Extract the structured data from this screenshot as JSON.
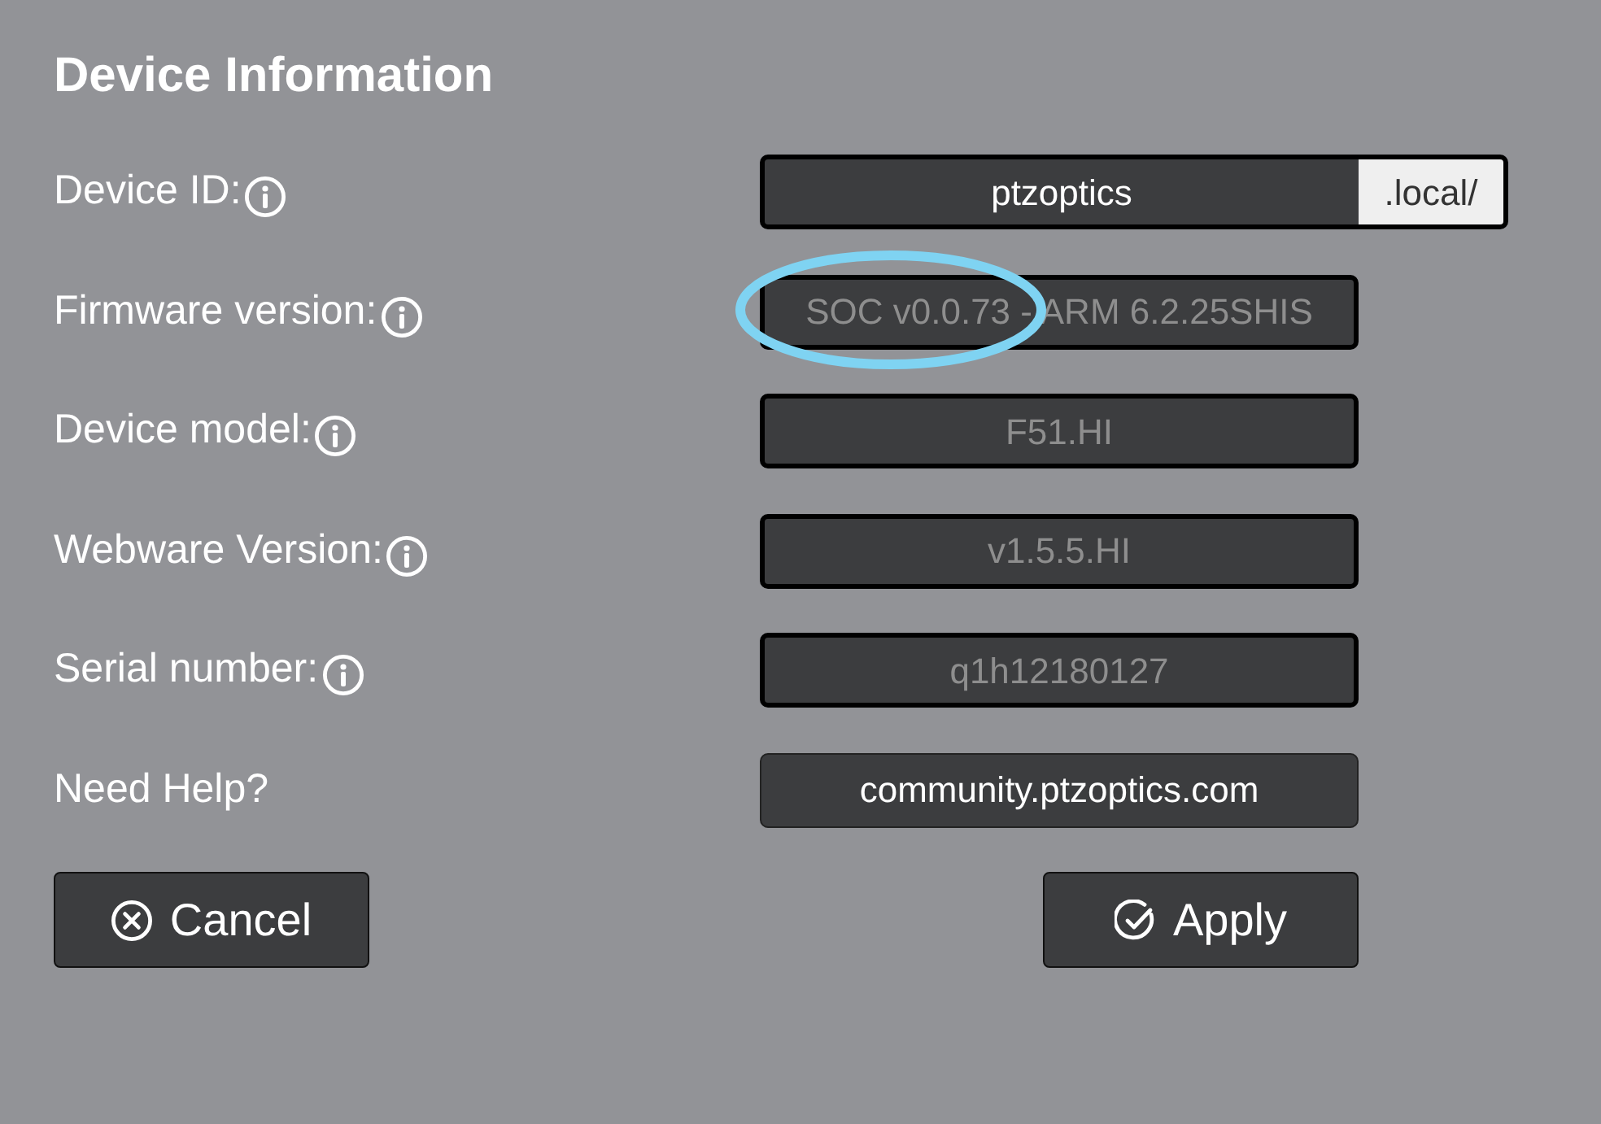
{
  "title": "Device Information",
  "rows": [
    {
      "label": "Device ID:",
      "info_icon": true,
      "highlighted": false,
      "field": {
        "kind": "input",
        "value": "ptzoptics",
        "disabled": false,
        "suffix": ".local/"
      }
    },
    {
      "label": "Firmware version:",
      "info_icon": true,
      "highlighted": true,
      "field": {
        "kind": "input",
        "value": "SOC v0.0.73 - ARM 6.2.25SHIS",
        "disabled": true
      }
    },
    {
      "label": "Device model:",
      "info_icon": true,
      "highlighted": false,
      "field": {
        "kind": "input",
        "value": "F51.HI",
        "disabled": true
      }
    },
    {
      "label": "Webware Version:",
      "info_icon": true,
      "highlighted": false,
      "field": {
        "kind": "input",
        "value": "v1.5.5.HI",
        "disabled": true
      }
    },
    {
      "label": "Serial number:",
      "info_icon": true,
      "highlighted": false,
      "field": {
        "kind": "input",
        "value": "q1h12180127",
        "disabled": true
      }
    },
    {
      "label": "Need Help?",
      "info_icon": false,
      "highlighted": false,
      "field": {
        "kind": "link",
        "value": "community.ptzoptics.com"
      }
    }
  ],
  "buttons": [
    {
      "label": "Cancel",
      "kind": "cancel"
    },
    {
      "label": "Apply",
      "kind": "apply"
    }
  ]
}
